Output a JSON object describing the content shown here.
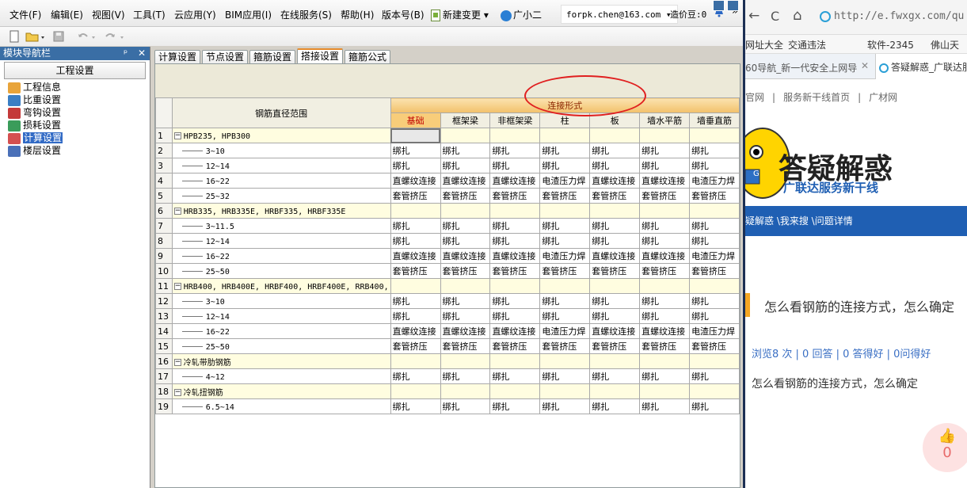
{
  "menu": [
    "文件(F)",
    "编辑(E)",
    "视图(V)",
    "工具(T)",
    "云应用(Y)",
    "BIM应用(I)",
    "在线服务(S)",
    "帮助(H)",
    "版本号(B)",
    "新建变更",
    "广小二"
  ],
  "menu_dropdown_glyph": "▾",
  "menu_more_glyph": "»",
  "user": {
    "email": "forpk.chen@163.com",
    "caret": "▾",
    "coins_label": "造价豆:0"
  },
  "nav": {
    "title": "模块导航栏",
    "pin": "ᵖ",
    "close": "✕",
    "header": "工程设置",
    "items": [
      {
        "label": "工程信息",
        "icon": "info-icon"
      },
      {
        "label": "比重设置",
        "icon": "weight-icon"
      },
      {
        "label": "弯钩设置",
        "icon": "hook-icon"
      },
      {
        "label": "损耗设置",
        "icon": "loss-icon"
      },
      {
        "label": "计算设置",
        "icon": "calc-icon",
        "selected": true
      },
      {
        "label": "楼层设置",
        "icon": "floor-icon"
      }
    ]
  },
  "tabs": [
    {
      "label": "计算设置"
    },
    {
      "label": "节点设置"
    },
    {
      "label": "箍筋设置"
    },
    {
      "label": "搭接设置",
      "active": true
    },
    {
      "label": "箍筋公式"
    }
  ],
  "grid": {
    "range_header": "钢筋直径范围",
    "group_header": "连接形式",
    "columns": [
      "基础",
      "框架梁",
      "非框架梁",
      "柱",
      "板",
      "墙水平筋",
      "墙垂直筋"
    ],
    "rows": [
      {
        "n": "1",
        "type": "group",
        "label": "HPB235, HPB300",
        "toggle": "−"
      },
      {
        "n": "2",
        "type": "sub",
        "label": "3~10",
        "cells": [
          "绑扎",
          "绑扎",
          "绑扎",
          "绑扎",
          "绑扎",
          "绑扎",
          "绑扎"
        ]
      },
      {
        "n": "3",
        "type": "sub",
        "label": "12~14",
        "cells": [
          "绑扎",
          "绑扎",
          "绑扎",
          "绑扎",
          "绑扎",
          "绑扎",
          "绑扎"
        ]
      },
      {
        "n": "4",
        "type": "sub",
        "label": "16~22",
        "cells": [
          "直螺纹连接",
          "直螺纹连接",
          "直螺纹连接",
          "电渣压力焊",
          "直螺纹连接",
          "直螺纹连接",
          "电渣压力焊"
        ]
      },
      {
        "n": "5",
        "type": "sub",
        "label": "25~32",
        "cells": [
          "套管挤压",
          "套管挤压",
          "套管挤压",
          "套管挤压",
          "套管挤压",
          "套管挤压",
          "套管挤压"
        ]
      },
      {
        "n": "6",
        "type": "group",
        "label": "HRB335, HRB335E, HRBF335, HRBF335E",
        "toggle": "−"
      },
      {
        "n": "7",
        "type": "sub",
        "label": "3~11.5",
        "cells": [
          "绑扎",
          "绑扎",
          "绑扎",
          "绑扎",
          "绑扎",
          "绑扎",
          "绑扎"
        ]
      },
      {
        "n": "8",
        "type": "sub",
        "label": "12~14",
        "cells": [
          "绑扎",
          "绑扎",
          "绑扎",
          "绑扎",
          "绑扎",
          "绑扎",
          "绑扎"
        ]
      },
      {
        "n": "9",
        "type": "sub",
        "label": "16~22",
        "cells": [
          "直螺纹连接",
          "直螺纹连接",
          "直螺纹连接",
          "电渣压力焊",
          "直螺纹连接",
          "直螺纹连接",
          "电渣压力焊"
        ]
      },
      {
        "n": "10",
        "type": "sub",
        "label": "25~50",
        "cells": [
          "套管挤压",
          "套管挤压",
          "套管挤压",
          "套管挤压",
          "套管挤压",
          "套管挤压",
          "套管挤压"
        ]
      },
      {
        "n": "11",
        "type": "group",
        "label": "HRB400, HRB400E, HRBF400, HRBF400E, RRB400,",
        "toggle": "−"
      },
      {
        "n": "12",
        "type": "sub",
        "label": "3~10",
        "cells": [
          "绑扎",
          "绑扎",
          "绑扎",
          "绑扎",
          "绑扎",
          "绑扎",
          "绑扎"
        ]
      },
      {
        "n": "13",
        "type": "sub",
        "label": "12~14",
        "cells": [
          "绑扎",
          "绑扎",
          "绑扎",
          "绑扎",
          "绑扎",
          "绑扎",
          "绑扎"
        ]
      },
      {
        "n": "14",
        "type": "sub",
        "label": "16~22",
        "cells": [
          "直螺纹连接",
          "直螺纹连接",
          "直螺纹连接",
          "电渣压力焊",
          "直螺纹连接",
          "直螺纹连接",
          "电渣压力焊"
        ]
      },
      {
        "n": "15",
        "type": "sub",
        "label": "25~50",
        "cells": [
          "套管挤压",
          "套管挤压",
          "套管挤压",
          "套管挤压",
          "套管挤压",
          "套管挤压",
          "套管挤压"
        ]
      },
      {
        "n": "16",
        "type": "group",
        "label": "冷轧带肋钢筋",
        "toggle": "−"
      },
      {
        "n": "17",
        "type": "sub",
        "label": "4~12",
        "cells": [
          "绑扎",
          "绑扎",
          "绑扎",
          "绑扎",
          "绑扎",
          "绑扎",
          "绑扎"
        ]
      },
      {
        "n": "18",
        "type": "group",
        "label": "冷轧扭钢筋",
        "toggle": "−"
      },
      {
        "n": "19",
        "type": "sub",
        "label": "6.5~14",
        "cells": [
          "绑扎",
          "绑扎",
          "绑扎",
          "绑扎",
          "绑扎",
          "绑扎",
          "绑扎"
        ]
      }
    ]
  },
  "browser": {
    "address": "http://e.fwxgx.com/qu",
    "back": "←",
    "reload": "C",
    "home": "⌂",
    "close": "✕",
    "bookmarks": [
      "网址大全",
      "交通违法",
      "软件-2345",
      "佛山天"
    ],
    "tabs": [
      "60导航_新一代安全上网导",
      "答疑解惑_广联达服"
    ],
    "site_nav": [
      "官网",
      "服务新干线首页",
      "广材网"
    ],
    "site_nav_sep": "|",
    "banner_title": "答疑解惑",
    "banner_sub": "广联达服务新干线",
    "mascot_tag": "G",
    "crumbs": "疑解惑 \\我来搜 \\问题详情",
    "question_title": "怎么看钢筋的连接方式，怎么确定",
    "stats": "浏览8 次 | 0 回答 | 0 答得好 | 0问得好",
    "question_body": "怎么看钢筋的连接方式，怎么确定",
    "like_icon": "👍",
    "likes": "0"
  }
}
